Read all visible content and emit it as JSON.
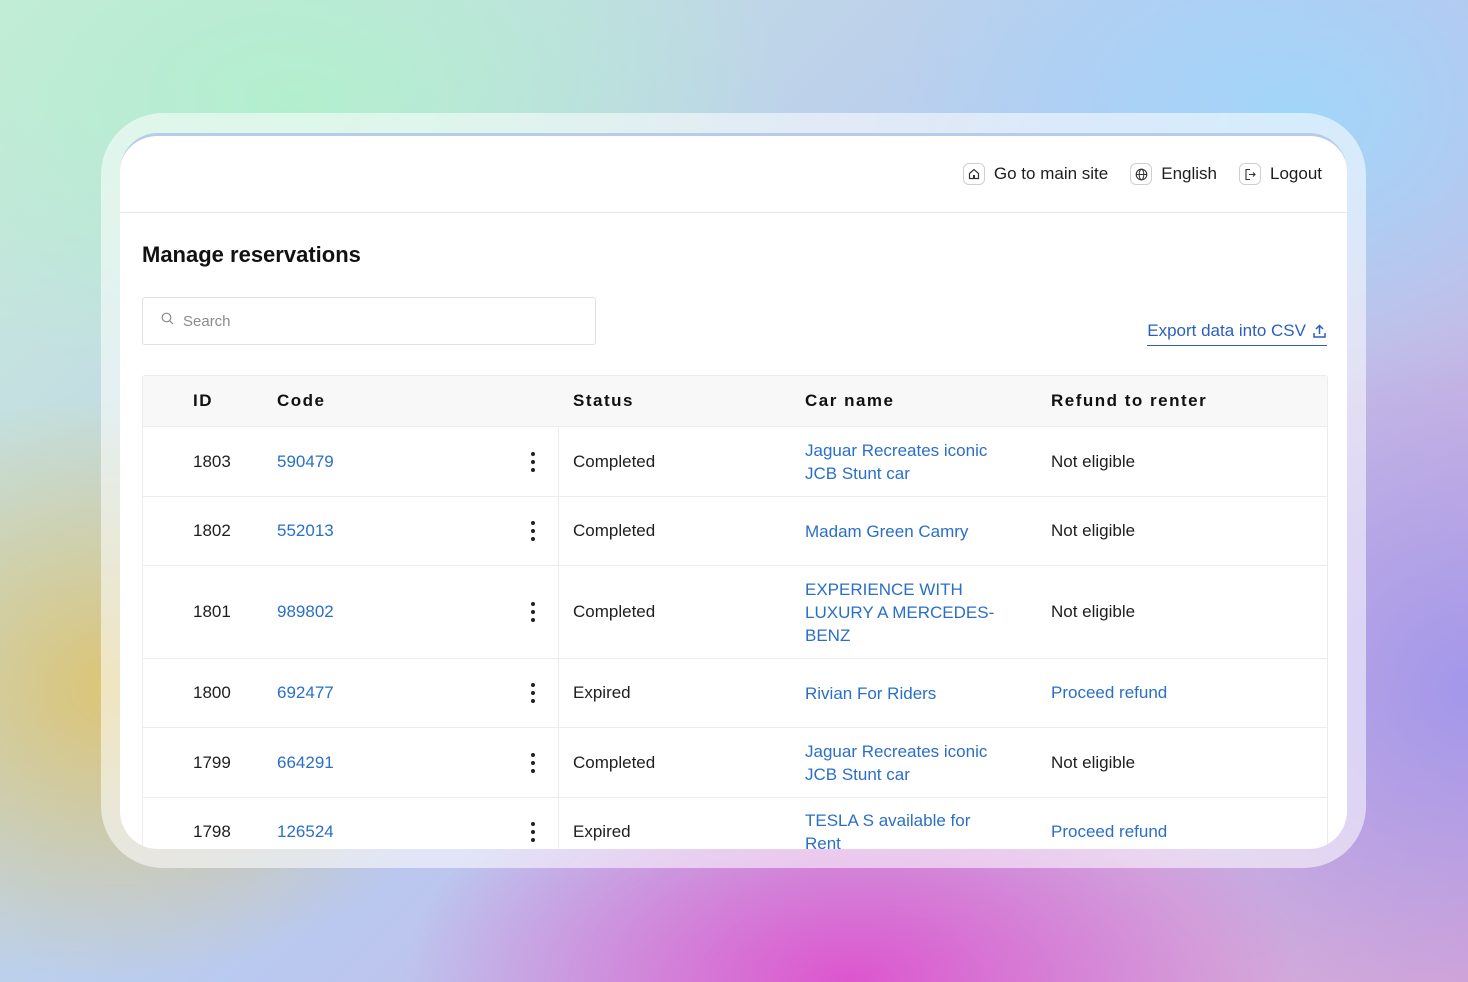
{
  "topbar": {
    "links": [
      {
        "label": "Go to main site",
        "icon": "home-icon"
      },
      {
        "label": "English",
        "icon": "globe-icon"
      },
      {
        "label": "Logout",
        "icon": "logout-icon"
      }
    ]
  },
  "page": {
    "title": "Manage reservations",
    "search_placeholder": "Search",
    "export_label": "Export data into CSV"
  },
  "table": {
    "headers": {
      "id": "ID",
      "code": "Code",
      "status": "Status",
      "car": "Car name",
      "refund": "Refund to renter"
    },
    "rows": [
      {
        "id": "1803",
        "code": "590479",
        "status": "Completed",
        "car": "Jaguar Recreates iconic JCB Stunt car",
        "refund": "Not eligible",
        "refund_link": false
      },
      {
        "id": "1802",
        "code": "552013",
        "status": "Completed",
        "car": "Madam Green Camry",
        "refund": "Not eligible",
        "refund_link": false
      },
      {
        "id": "1801",
        "code": "989802",
        "status": "Completed",
        "car": "EXPERIENCE WITH LUXURY A MERCEDES-BENZ",
        "refund": "Not eligible",
        "refund_link": false
      },
      {
        "id": "1800",
        "code": "692477",
        "status": "Expired",
        "car": "Rivian For Riders",
        "refund": "Proceed refund",
        "refund_link": true
      },
      {
        "id": "1799",
        "code": "664291",
        "status": "Completed",
        "car": "Jaguar Recreates iconic JCB Stunt car",
        "refund": "Not eligible",
        "refund_link": false
      },
      {
        "id": "1798",
        "code": "126524",
        "status": "Expired",
        "car": "TESLA S available for Rent",
        "refund": "Proceed refund",
        "refund_link": true
      }
    ]
  },
  "colors": {
    "link": "#2a6fc7",
    "accent": "#2a5fbf"
  }
}
